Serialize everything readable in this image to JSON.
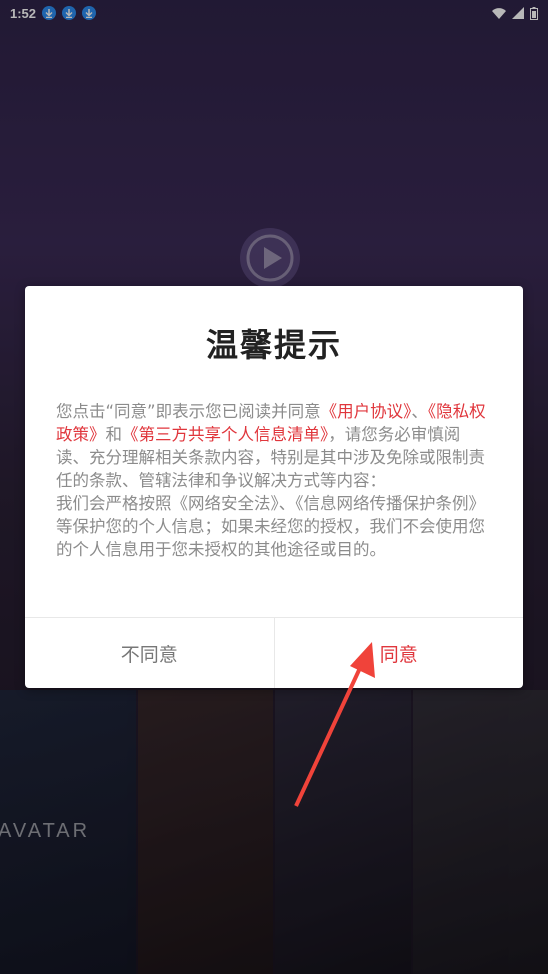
{
  "status_bar": {
    "time": "1:52",
    "icons": [
      "download-icon",
      "download-icon",
      "download-icon"
    ],
    "right_icons": [
      "wifi-icon",
      "signal-icon",
      "battery-icon"
    ]
  },
  "background": {
    "poster_text": "AVATAR"
  },
  "dialog": {
    "title": "温馨提示",
    "body": {
      "p1_a": "您点击“同意”即表示您已阅读并同意",
      "link_user_agreement": "《用户协议》",
      "sep1": "、",
      "link_privacy": "《隐私权政策》",
      "and": "和",
      "link_third_party": "《第三方共享个人信息清单》",
      "p1_b": "，请您务必审慎阅读、充分理解相关条款内容，特别是其中涉及免除或限制责任的条款、管辖法律和争议解决方式等内容：",
      "p2": "我们会严格按照《网络安全法》、《信息网络传播保护条例》等保护您的个人信息；如果未经您的授权，我们不会使用您的个人信息用于您未授权的其他途径或目的。"
    },
    "disagree_label": "不同意",
    "agree_label": "同意"
  },
  "colors": {
    "link": "#e0363c",
    "agree": "#e0363c",
    "arrow": "#f0433a"
  }
}
